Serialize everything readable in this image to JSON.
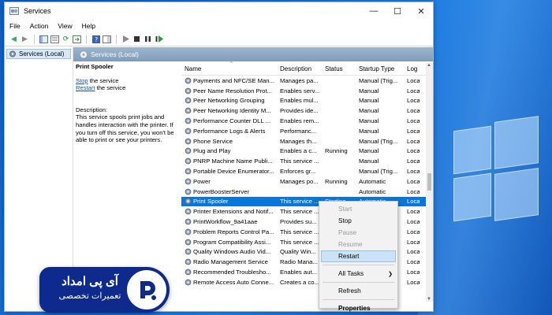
{
  "window": {
    "title": "Services",
    "controls": {
      "minimize": "—",
      "maximize": "☐",
      "close": "✕"
    }
  },
  "menubar": [
    "File",
    "Action",
    "View",
    "Help"
  ],
  "tree": {
    "root_label": "Services (Local)"
  },
  "main_header": "Services (Local)",
  "detail": {
    "service_title": "Print Spooler",
    "stop_link": "Stop",
    "stop_suffix": " the service",
    "restart_link": "Restart",
    "restart_suffix": " the service",
    "description_label": "Description:",
    "description": "This service spools print jobs and handles interaction with the printer. If you turn off this service, you won't be able to print or see your printers."
  },
  "columns": [
    "Name",
    "Description",
    "Status",
    "Startup Type",
    "Log"
  ],
  "rows": [
    {
      "name": "Payments and NFC/SE Man...",
      "desc": "Manages pa...",
      "status": "",
      "startup": "Manual (Trig...",
      "log": "Loca"
    },
    {
      "name": "Peer Name Resolution Prot...",
      "desc": "Enables serv...",
      "status": "",
      "startup": "Manual",
      "log": "Loca"
    },
    {
      "name": "Peer Networking Grouping",
      "desc": "Enables mul...",
      "status": "",
      "startup": "Manual",
      "log": "Loca"
    },
    {
      "name": "Peer Networking Identity M...",
      "desc": "Provides ide...",
      "status": "",
      "startup": "Manual",
      "log": "Loca"
    },
    {
      "name": "Performance Counter DLL ...",
      "desc": "Enables rem...",
      "status": "",
      "startup": "Manual",
      "log": "Loca"
    },
    {
      "name": "Performance Logs & Alerts",
      "desc": "Performanc...",
      "status": "",
      "startup": "Manual",
      "log": "Loca"
    },
    {
      "name": "Phone Service",
      "desc": "Manages th...",
      "status": "",
      "startup": "Manual (Trig...",
      "log": "Loca"
    },
    {
      "name": "Plug and Play",
      "desc": "Enables a c...",
      "status": "Running",
      "startup": "Manual",
      "log": "Loca"
    },
    {
      "name": "PNRP Machine Name Publi...",
      "desc": "This service ...",
      "status": "",
      "startup": "Manual",
      "log": "Loca"
    },
    {
      "name": "Portable Device Enumerator...",
      "desc": "Enforces gr...",
      "status": "",
      "startup": "Manual (Trig...",
      "log": "Loca"
    },
    {
      "name": "Power",
      "desc": "Manages po...",
      "status": "Running",
      "startup": "Automatic",
      "log": "Loca"
    },
    {
      "name": "PowerBoosterServer",
      "desc": "",
      "status": "",
      "startup": "Automatic",
      "log": "Loca"
    },
    {
      "name": "Print Spooler",
      "desc": "This service ...",
      "status": "Starting",
      "startup": "Automatic",
      "log": "Loca",
      "selected": true
    },
    {
      "name": "Printer Extensions and Notif...",
      "desc": "This service ...",
      "status": "",
      "startup": "",
      "log": "Loca"
    },
    {
      "name": "PrintWorkflow_9a41aae",
      "desc": "Provides su...",
      "status": "",
      "startup": "",
      "log": "Loca"
    },
    {
      "name": "Problem Reports Control Pa...",
      "desc": "This service ...",
      "status": "",
      "startup": "",
      "log": "Loca"
    },
    {
      "name": "Program Compatibility Assi...",
      "desc": "This service ...",
      "status": "",
      "startup": "",
      "log": "Loca"
    },
    {
      "name": "Quality Windows Audio Vid...",
      "desc": "Quality Win...",
      "status": "",
      "startup": "",
      "log": "Loca"
    },
    {
      "name": "Radio Management Service",
      "desc": "Radio Mana...",
      "status": "",
      "startup": "",
      "log": "Loca"
    },
    {
      "name": "Recommended Troublesho...",
      "desc": "Enables aut...",
      "status": "",
      "startup": "",
      "log": "Loca"
    },
    {
      "name": "Remote Access Auto Conne...",
      "desc": "Creates a co...",
      "status": "",
      "startup": "",
      "log": "Loca"
    }
  ],
  "context_menu": {
    "items": [
      {
        "label": "Start",
        "enabled": false
      },
      {
        "label": "Stop",
        "enabled": true
      },
      {
        "label": "Pause",
        "enabled": false
      },
      {
        "label": "Resume",
        "enabled": false
      },
      {
        "label": "Restart",
        "enabled": true,
        "highlighted": true
      }
    ],
    "all_tasks": "All Tasks",
    "refresh": "Refresh",
    "properties": "Properties"
  },
  "badge": {
    "line1": "آی پی امداد",
    "line2": "تعمیرات تخصصی"
  },
  "colors": {
    "selection": "#0a77d8",
    "header_blue": "#7f9cb9",
    "link": "#1553b6",
    "badge_navy": "#0d2a8c",
    "desktop_blue": "#0b5fcc"
  }
}
